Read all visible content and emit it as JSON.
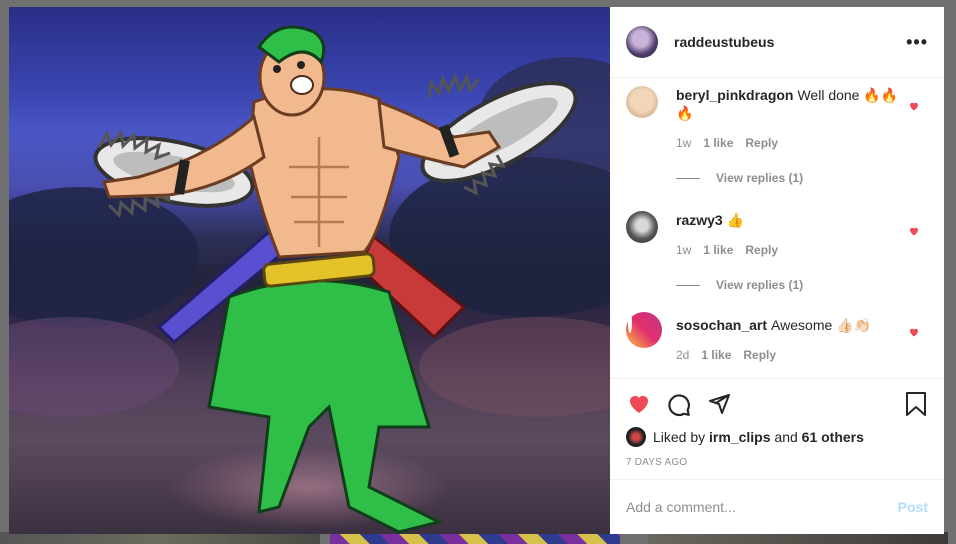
{
  "post": {
    "owner": "raddeustubeus",
    "more_icon": "•••"
  },
  "comments": [
    {
      "user": "beryl_pinkdragon",
      "text": "Well done 🔥🔥🔥",
      "age": "1w",
      "likes": "1 like",
      "reply": "Reply",
      "view_replies": "View replies (1)"
    },
    {
      "user": "razwy3",
      "text": "👍",
      "age": "1w",
      "likes": "1 like",
      "reply": "Reply",
      "view_replies": "View replies (1)"
    },
    {
      "user": "sosochan_art",
      "text": "Awesome 👍🏻👏🏻",
      "age": "2d",
      "likes": "1 like",
      "reply": "Reply"
    }
  ],
  "likes": {
    "prefix": "Liked by",
    "user": "irm_clips",
    "conj": "and",
    "others": "61 others"
  },
  "timestamp": "7 DAYS AGO",
  "add_comment": {
    "placeholder": "Add a comment...",
    "post_label": "Post"
  },
  "colors": {
    "like_red": "#ed4956",
    "link_blue_disabled": "#b3dbff",
    "muted_text": "#8e8e8e"
  },
  "icons": {
    "like": "heart-icon",
    "comment": "comment-icon",
    "share": "share-icon",
    "save": "bookmark-icon",
    "more": "more-options-icon"
  }
}
